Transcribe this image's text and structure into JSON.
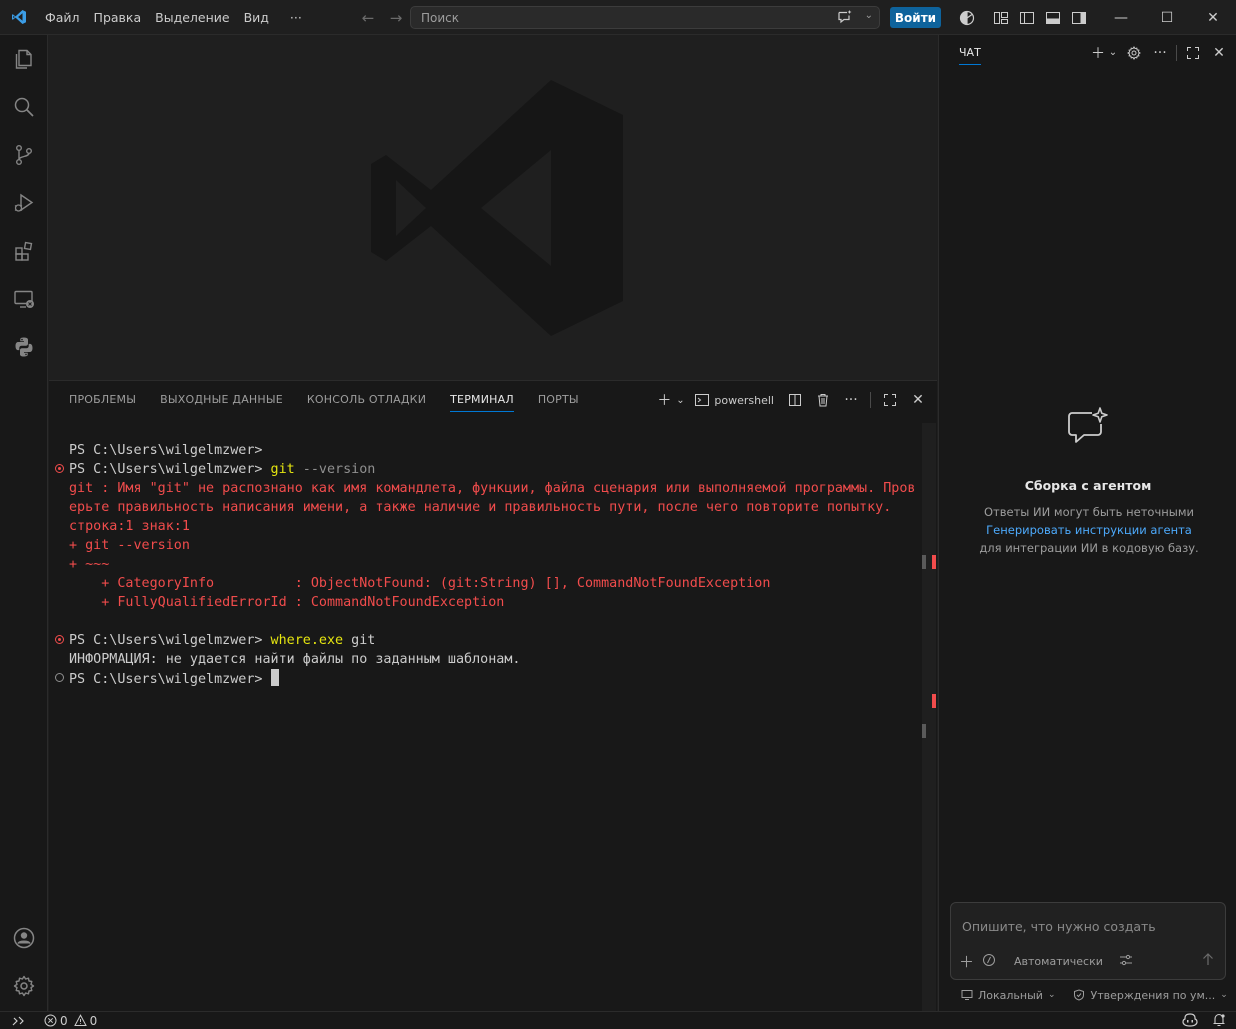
{
  "menu": [
    "Файл",
    "Правка",
    "Выделение",
    "Вид",
    "···"
  ],
  "search": {
    "placeholder": "Поиск"
  },
  "signin_label": "Войти",
  "panel": {
    "tabs": [
      "ПРОБЛЕМЫ",
      "ВЫХОДНЫЕ ДАННЫЕ",
      "КОНСОЛЬ ОТЛАДКИ",
      "ТЕРМИНАЛ",
      "ПОРТЫ"
    ],
    "active_tab": "ТЕРМИНАЛ",
    "shell_name": "powershell"
  },
  "terminal": {
    "line1": "PS C:\\Users\\wilgelmzwer>",
    "line2_prompt": "PS C:\\Users\\wilgelmzwer> ",
    "line2_cmd": "git",
    "line2_arg": " --version",
    "err1": "git : Имя \"git\" не распознано как имя командлета, функции, файла сценария или выполняемой программы. Пров",
    "err2": "ерьте правильность написания имени, а также наличие и правильность пути, после чего повторите попытку.",
    "err3": "строка:1 знак:1",
    "err4": "+ git --version",
    "err5": "+ ~~~",
    "err6": "    + CategoryInfo          : ObjectNotFound: (git:String) [], CommandNotFoundException",
    "err7": "    + FullyQualifiedErrorId : CommandNotFoundException",
    "line3_prompt": "PS C:\\Users\\wilgelmzwer> ",
    "line3_cmd": "where.exe",
    "line3_arg": " git",
    "info": "ИНФОРМАЦИЯ: не удается найти файлы по заданным шаблонам.",
    "line4_prompt": "PS C:\\Users\\wilgelmzwer> "
  },
  "chat": {
    "title": "ЧАТ",
    "empty_title": "Сборка с агентом",
    "empty_desc_1": "Ответы ИИ могут быть неточными",
    "empty_link": "Генерировать инструкции агента",
    "empty_desc_2": " для интеграции ИИ в кодовую базу.",
    "input_placeholder": "Опишите, что нужно создать",
    "mode_label": "Автоматически",
    "footer_local": "Локальный",
    "footer_approvals": "Утверждения по ум..."
  },
  "status": {
    "errors": "0",
    "warnings": "0"
  },
  "colors": {
    "accent": "#0078d4",
    "signin": "#0e639c",
    "error": "#f14c4c",
    "command": "#e5e510",
    "link": "#4daafc"
  }
}
